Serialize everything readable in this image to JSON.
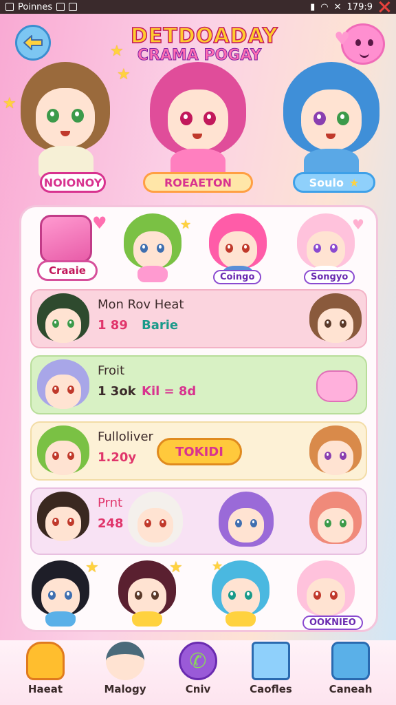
{
  "status_bar": {
    "app_label": "Poinnes",
    "time": "179:9"
  },
  "header": {
    "logo_line1": "DETDOADAY",
    "logo_line2": "CRAMA POGAY"
  },
  "heroes": [
    {
      "name": "NOIONOY",
      "pill_color": "#d8338f"
    },
    {
      "name": "ROEAETON",
      "pill_color": "#ff9f43"
    },
    {
      "name": "Soulo",
      "pill_color": "#3ea0e8"
    }
  ],
  "create": {
    "label": "Craaie"
  },
  "top_characters": [
    {
      "label": ""
    },
    {
      "label": "Coingo"
    },
    {
      "label": "Songyo"
    }
  ],
  "rows": [
    {
      "title": "Mon Rov Heat",
      "stat": "1 89",
      "badge": "Barie"
    },
    {
      "title": "Froit",
      "stat": "1 3ok",
      "badge": "Kil = 8d"
    },
    {
      "title": "Fulloliver",
      "stat": "1.20y",
      "button": "TOKIDI"
    },
    {
      "title": "Prnt",
      "stat": "248"
    }
  ],
  "bottom_characters": [
    {
      "label": ""
    },
    {
      "label": ""
    },
    {
      "label": ""
    },
    {
      "label": "OOKNIEO"
    }
  ],
  "nav": [
    {
      "label": "Haeat",
      "icon": "yellow-blob-icon"
    },
    {
      "label": "Malogy",
      "icon": "character-icon"
    },
    {
      "label": "Cniv",
      "icon": "phone-icon"
    },
    {
      "label": "Caofles",
      "icon": "mail-icon"
    },
    {
      "label": "Caneah",
      "icon": "box-icon"
    }
  ],
  "colors": {
    "accent_pink": "#e85ca8",
    "accent_yellow": "#ffcc2e",
    "accent_blue": "#3ea0e8"
  }
}
